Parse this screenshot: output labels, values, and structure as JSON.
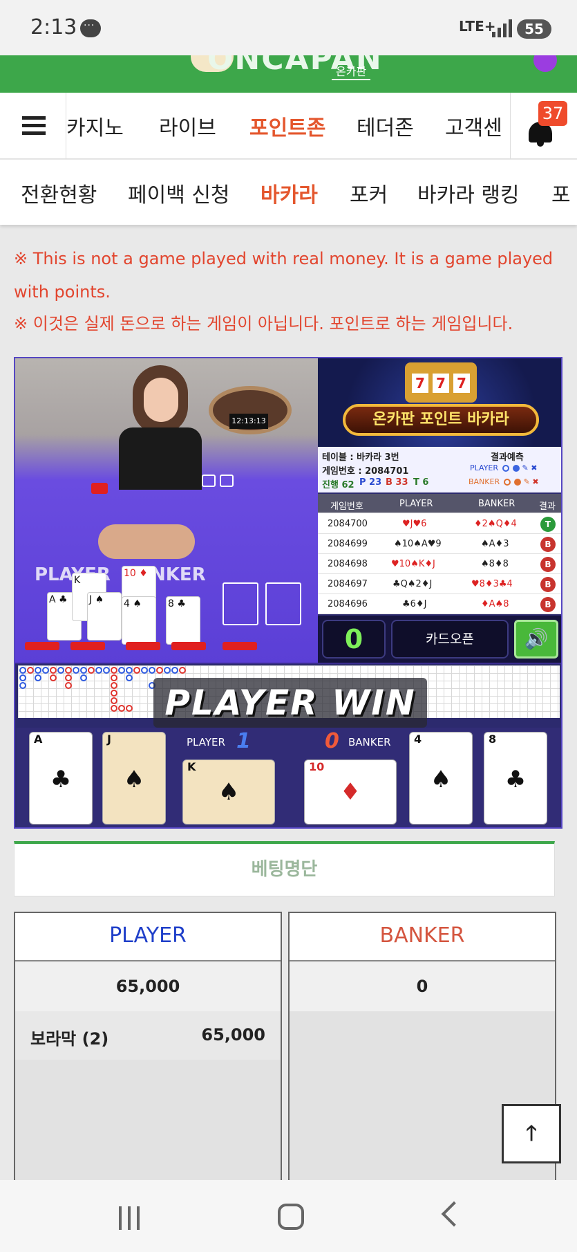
{
  "status_bar": {
    "time": "2:13",
    "network": "LTE+",
    "battery": "55"
  },
  "header": {
    "logo_text": "ONCAPAN",
    "logo_sub": "온카판",
    "notification_count": "37"
  },
  "main_nav": {
    "items": [
      "카지노",
      "라이브",
      "포인트존",
      "테더존",
      "고객센"
    ],
    "active": "포인트존"
  },
  "sub_nav": {
    "items": [
      "전환현황",
      "페이백 신청",
      "바카라",
      "포커",
      "바카라 랭킹",
      "포"
    ],
    "active": "바카라"
  },
  "notice": {
    "english": "※ This is not a game played with real money. It is a game played with points.",
    "korean": "※ 이것은 실제 돈으로 하는 게임이 아닙니다. 포인트로 하는 게임입니다."
  },
  "game": {
    "banner_title": "온카판 포인트 바카라",
    "table_label": "테이블 : 바카라 3번",
    "game_number_label": "게임번호 : 2084701",
    "progress_label": "진행 62",
    "progress_p": "P 23",
    "progress_b": "B 33",
    "progress_t": "T 6",
    "prediction_label": "결과예측",
    "prediction_player": "PLAYER",
    "prediction_banker": "BANKER",
    "video_clock": "12:13:13",
    "video_player_label": "PLAYER",
    "video_banker_label": "BANKER",
    "history_headers": [
      "게임번호",
      "PLAYER",
      "BANKER",
      "결과"
    ],
    "history": [
      {
        "id": "2084700",
        "player": "♥J♥6",
        "banker": "♦2♠Q♦4",
        "result": "T"
      },
      {
        "id": "2084699",
        "player": "♠10♠A♥9",
        "banker": "♠A♦3",
        "result": "B"
      },
      {
        "id": "2084698",
        "player": "♥10♠K♦J",
        "banker": "♠8♦8",
        "result": "B"
      },
      {
        "id": "2084697",
        "player": "♣Q♠2♦J",
        "banker": "♥8♦3♣4",
        "result": "B"
      },
      {
        "id": "2084696",
        "player": "♣6♦J",
        "banker": "♦A♠8",
        "result": "B"
      }
    ],
    "countdown": "0",
    "card_open_label": "카드오픈",
    "win_text": "PLAYER WIN",
    "player_label": "PLAYER",
    "player_score": "1",
    "banker_label": "BANKER",
    "banker_score": "0",
    "player_cards": [
      {
        "rank": "A",
        "suit": "♣"
      },
      {
        "rank": "J",
        "suit": "♠"
      },
      {
        "rank": "K",
        "suit": "♠"
      }
    ],
    "banker_cards": [
      {
        "rank": "10",
        "suit": "♦"
      },
      {
        "rank": "4",
        "suit": "♠"
      },
      {
        "rank": "8",
        "suit": "♣"
      }
    ]
  },
  "bet_list": {
    "title": "베팅명단",
    "player": {
      "label": "PLAYER",
      "total": "65,000",
      "entries": [
        {
          "name": "보라막 (2)",
          "amount": "65,000"
        }
      ]
    },
    "banker": {
      "label": "BANKER",
      "total": "0"
    }
  },
  "colors": {
    "brand_green": "#3da74a",
    "accent_orange": "#e4572e",
    "notice_red": "#e2452e",
    "player_blue": "#1f3fc9",
    "banker_red": "#d4553f"
  },
  "icons": [
    "menu-icon",
    "bell-icon",
    "sound-icon",
    "arrow-up-icon",
    "recent-apps-icon",
    "home-icon",
    "back-icon"
  ]
}
